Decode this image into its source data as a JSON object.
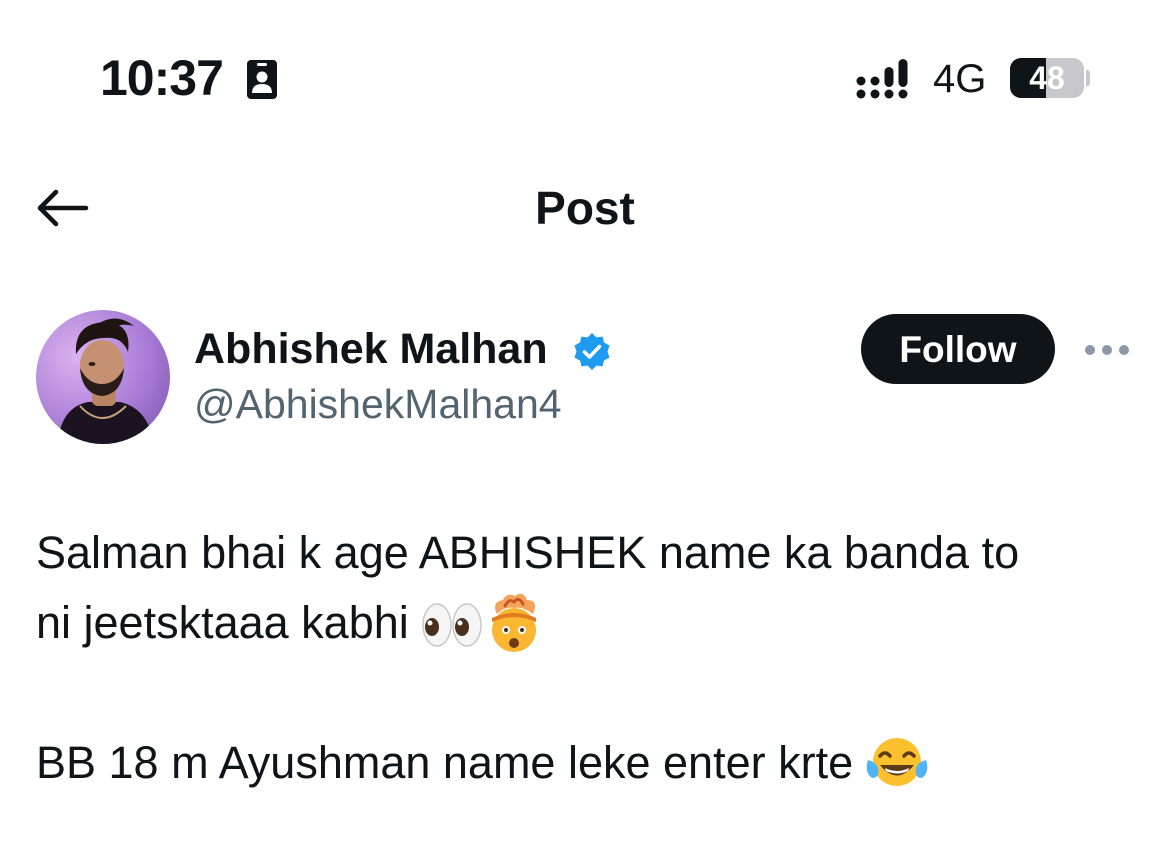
{
  "status_bar": {
    "time": "10:37",
    "network": "4G",
    "battery_level": "48",
    "battery_fraction": 0.48,
    "icons": [
      "contact-card-icon",
      "signal-strength-icon"
    ]
  },
  "header": {
    "title": "Post",
    "back_icon": "arrow-left-icon"
  },
  "post": {
    "author": {
      "display_name": "Abhishek Malhan",
      "handle": "@AbhishekMalhan4",
      "verified": true,
      "verified_color": "#1d9bf0"
    },
    "follow_label": "Follow",
    "more_icon": "ellipsis-icon",
    "text": {
      "line1": "Salman bhai k age ABHISHEK name ka banda to",
      "line2": "ni jeetsktaaa kabhi",
      "line3": "BB 18 m Ayushman name leke enter krte"
    },
    "emojis": [
      "eyes-emoji",
      "exploding-head-emoji",
      "tears-of-joy-emoji"
    ]
  },
  "colors": {
    "text_primary": "#0f1419",
    "text_secondary": "#536471",
    "follow_bg": "#0f1419",
    "verified": "#1d9bf0"
  }
}
